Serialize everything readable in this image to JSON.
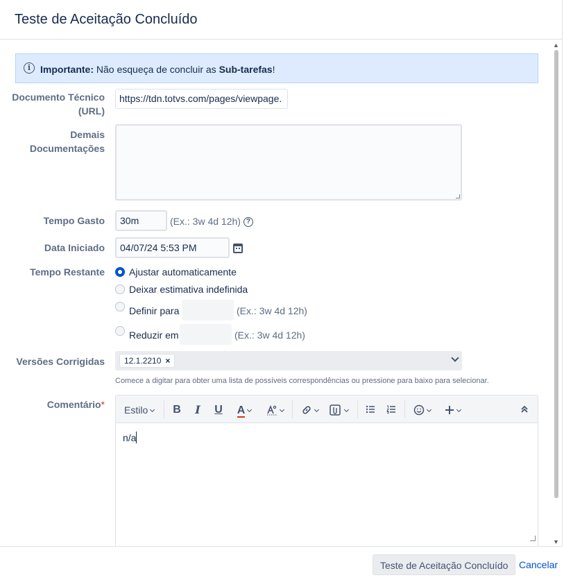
{
  "dialog": {
    "title": "Teste de Aceitação Concluído"
  },
  "info": {
    "icon": "info-icon",
    "strong": "Importante:",
    "text": " Não esqueça de concluir as ",
    "emph": "Sub-tarefas",
    "end": "!"
  },
  "fields": {
    "doc_tecnico": {
      "label_line1": "Documento Técnico",
      "label_line2": "(URL)",
      "value": "https://tdn.totvs.com/pages/viewpage."
    },
    "demais": {
      "label_line1": "Demais",
      "label_line2": "Documentações",
      "value": ""
    },
    "tempo_gasto": {
      "label": "Tempo Gasto",
      "value": "30m",
      "hint": "(Ex.: 3w 4d 12h)"
    },
    "data_iniciado": {
      "label": "Data Iniciado",
      "value": "04/07/24 5:53 PM"
    },
    "tempo_restante": {
      "label": "Tempo Restante",
      "options": [
        {
          "label": "Ajustar automaticamente",
          "selected": true
        },
        {
          "label": "Deixar estimativa indefinida",
          "selected": false
        },
        {
          "label": "Definir para",
          "selected": false,
          "hint": "(Ex.: 3w 4d 12h)"
        },
        {
          "label": "Reduzir em",
          "selected": false,
          "hint": "(Ex.: 3w 4d 12h)"
        }
      ]
    },
    "versoes": {
      "label": "Versões Corrigidas",
      "chip": "12.1.2210",
      "chip_remove": "×",
      "help": "Comece a digitar para obter uma lista de possíveis correspondências ou pressione para baixo para selecionar."
    },
    "comentario": {
      "label": "Comentário",
      "required_mark": "*",
      "text": "n/a",
      "toolbar": {
        "style": "Estilo",
        "bold": "B",
        "italic": "I",
        "underline": "U",
        "text_color": "A"
      }
    }
  },
  "footer": {
    "submit": "Teste de Aceitação Concluído",
    "cancel": "Cancelar"
  },
  "colors": {
    "accent": "#0052cc",
    "info_bg": "#deebff",
    "required": "#de350b",
    "text_color_bar": "#de350b"
  }
}
